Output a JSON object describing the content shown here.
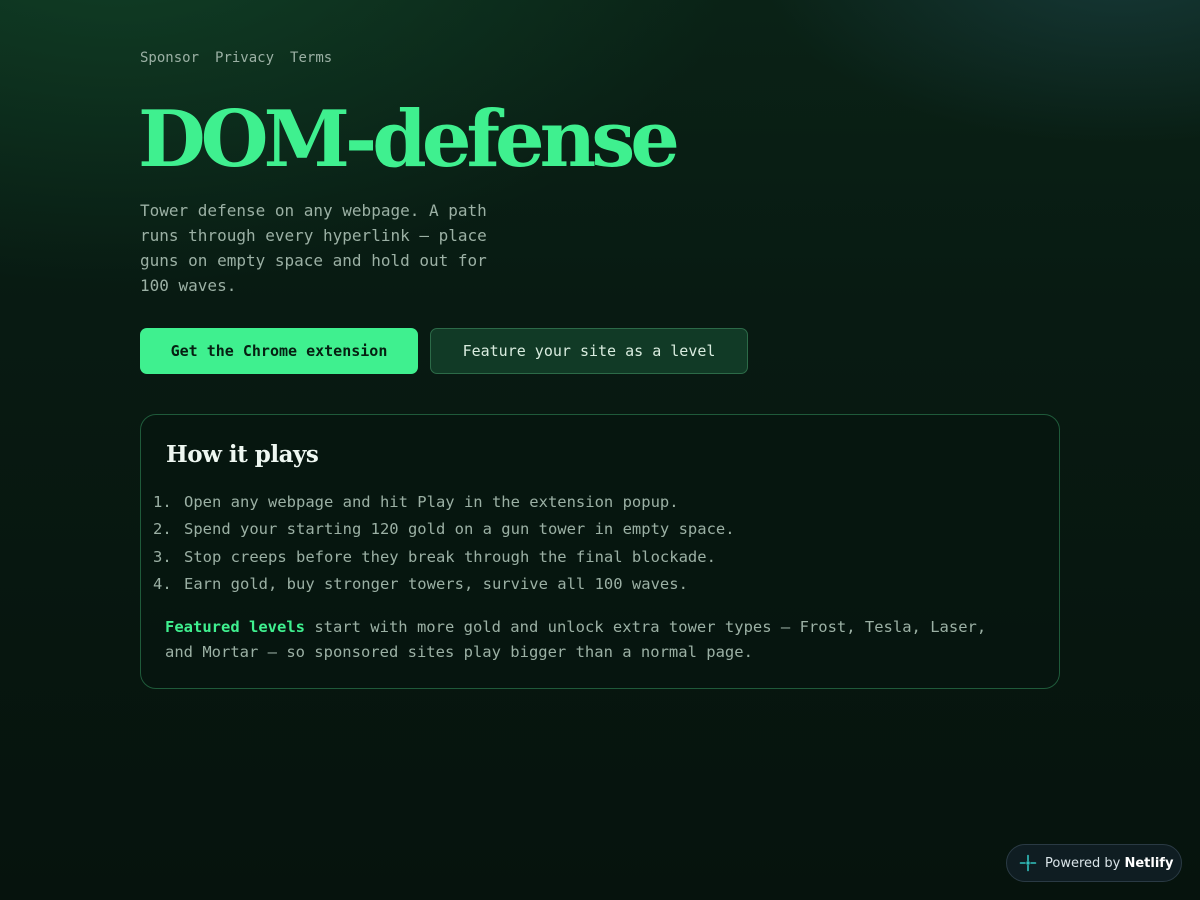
{
  "nav": {
    "links": [
      "Sponsor",
      "Privacy",
      "Terms"
    ]
  },
  "hero": {
    "title": "DOM-defense",
    "tagline": "Tower defense on any webpage. A path runs through every hyperlink — place guns on empty space and hold out for 100 waves.",
    "primary_button": "Get the Chrome extension",
    "secondary_button": "Feature your site as a level"
  },
  "how_it_plays": {
    "title": "How it plays",
    "steps": [
      {
        "num": "1.",
        "text": "Open any webpage and hit Play in the extension popup."
      },
      {
        "num": "2.",
        "text": "Spend your starting 120 gold on a gun tower in empty space."
      },
      {
        "num": "3.",
        "text": "Stop creeps before they break through the final blockade."
      },
      {
        "num": "4.",
        "text": "Earn gold, buy stronger towers, survive all 100 waves."
      }
    ],
    "featured_label": "Featured levels",
    "featured_text": " start with more gold and unlock extra tower types — Frost, Tesla, Laser, and Mortar — so sponsored sites play bigger than a normal page."
  },
  "badge": {
    "prefix": "Powered by ",
    "brand": "Netlify",
    "icon": "netlify-icon"
  },
  "colors": {
    "accent": "#3ff08f",
    "background": "#07150f",
    "muted_text": "#9bb0a4",
    "card_border": "#1f5a3a"
  }
}
